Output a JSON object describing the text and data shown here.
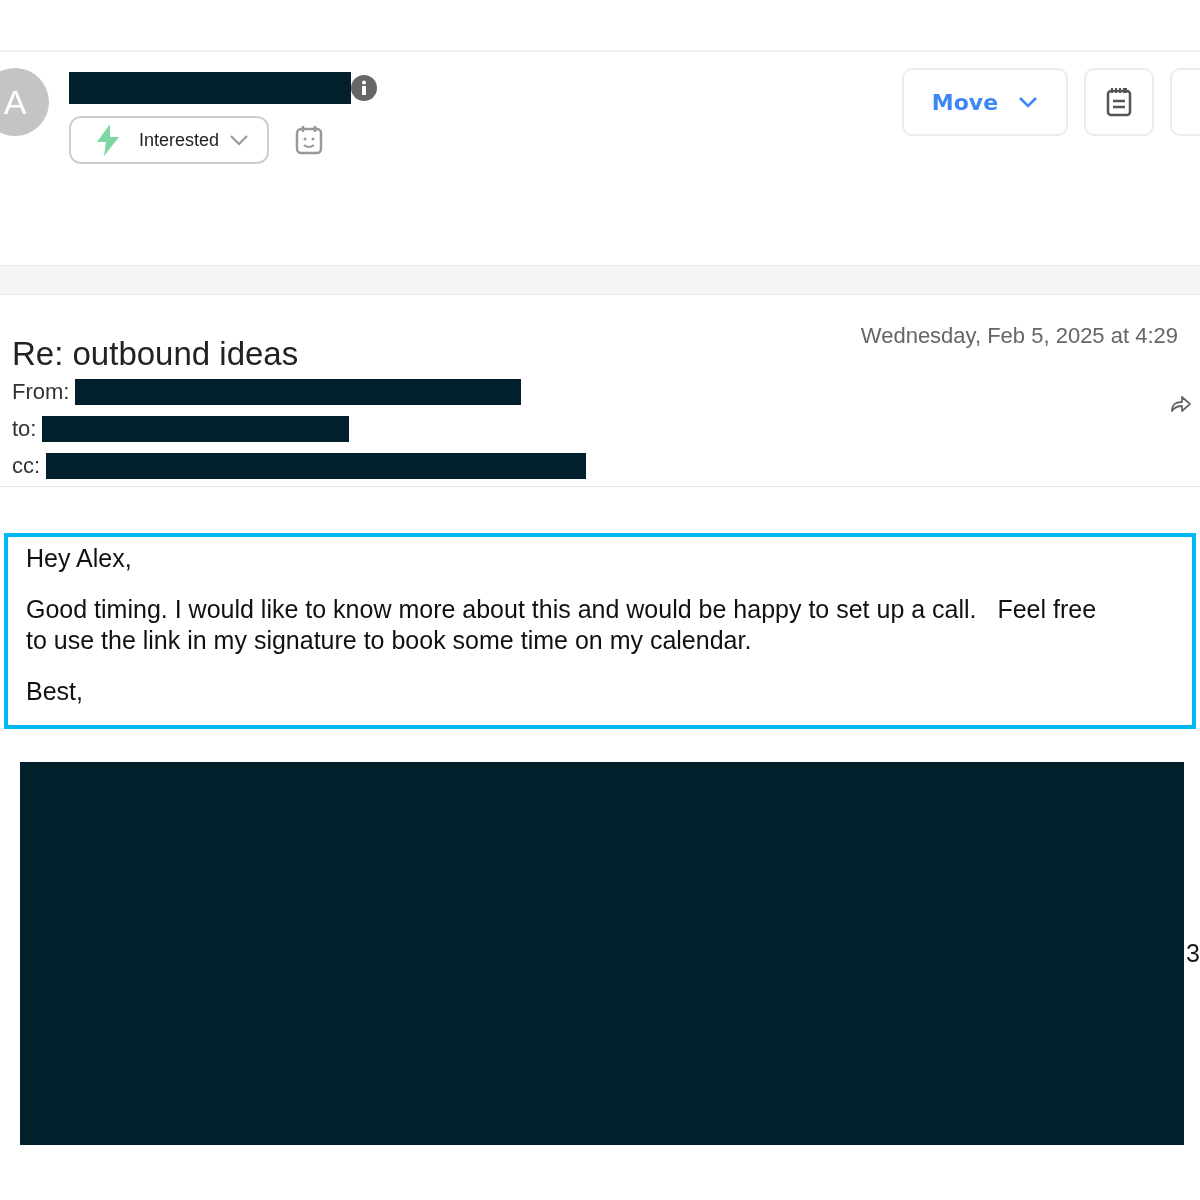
{
  "contact": {
    "avatar_letter": "A",
    "tag": {
      "label": "Interested"
    }
  },
  "toolbar": {
    "move_label": "Move"
  },
  "email": {
    "subject": "Re: outbound ideas",
    "date": "Wednesday, Feb 5, 2025 at 4:29",
    "fields": [
      {
        "label": "From:"
      },
      {
        "label": "to:"
      },
      {
        "label": "cc:"
      }
    ],
    "body": [
      {
        "lines": [
          "Hey Alex,"
        ]
      },
      {
        "lines": [
          "Good timing. I would like to know more about this and would be happy to set up a call.   Feel free",
          "to use the link in my signature to book some time on my calendar."
        ]
      },
      {
        "lines": [
          "Best,"
        ]
      }
    ],
    "signature_edge_text": "3"
  }
}
